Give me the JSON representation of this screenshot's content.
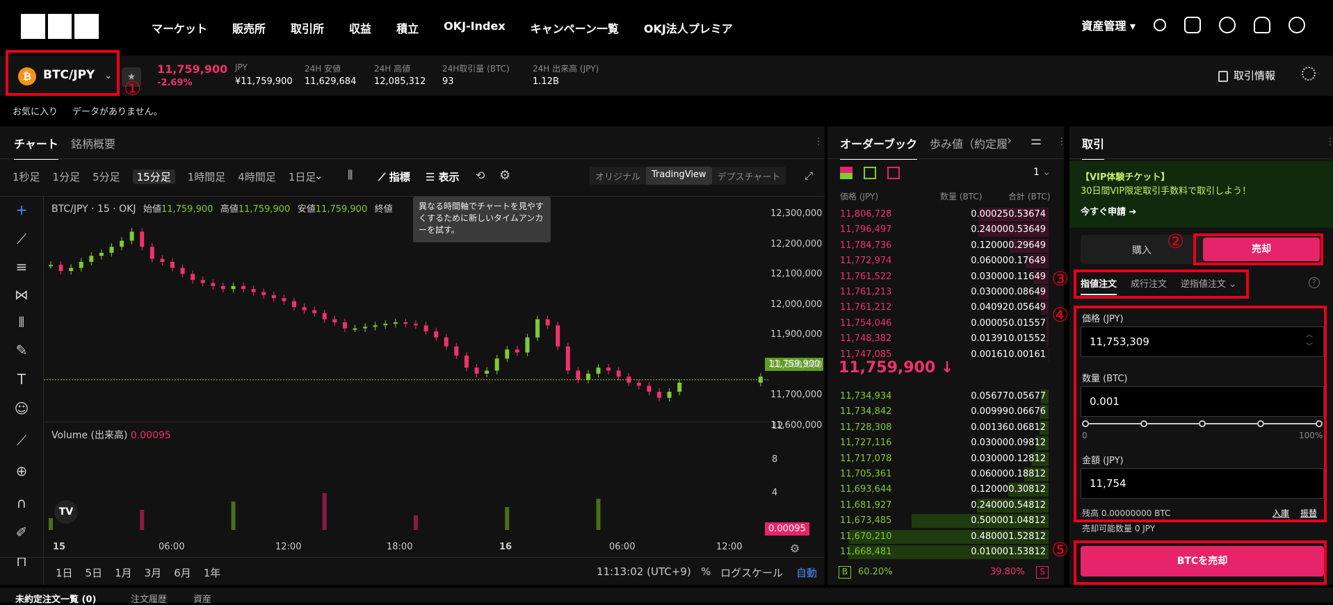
{
  "nav": {
    "links": [
      "マーケット",
      "販売所",
      "取引所",
      "収益",
      "積立",
      "OKJ-Index",
      "キャンペーン一覧",
      "OKJ法人プレミア"
    ],
    "asset_menu": "資産管理"
  },
  "ticker": {
    "pair": "BTC/JPY",
    "price": "11,759,900",
    "change": "-2.69%",
    "stats": [
      {
        "label": "JPY",
        "value": "¥11,759,900"
      },
      {
        "label": "24H 安値",
        "value": "11,629,684"
      },
      {
        "label": "24H 高値",
        "value": "12,085,312"
      },
      {
        "label": "24H取引量 (BTC)",
        "value": "93"
      },
      {
        "label": "24H 出来高 (JPY)",
        "value": "1.12B"
      }
    ],
    "trade_info": "取引情報"
  },
  "favorites": {
    "label": "お気に入り",
    "empty": "データがありません。"
  },
  "chart": {
    "tabs": [
      "チャート",
      "銘柄概要"
    ],
    "timeframes": [
      "1秒足",
      "1分足",
      "5分足",
      "15分足",
      "1時間足",
      "4時間足",
      "1日足"
    ],
    "active_tf": "15分足",
    "indicator": "指標",
    "display": "表示",
    "views": [
      "オリジナル",
      "TradingView",
      "デプスチャート"
    ],
    "active_view": "TradingView",
    "legend": {
      "symbol": "BTC/JPY · 15 · OKJ",
      "open_l": "始値",
      "open": "11,759,900",
      "high_l": "高値",
      "high": "11,759,900",
      "low_l": "安値",
      "low": "11,759,900",
      "close_l": "終値"
    },
    "tooltip": "異なる時間軸でチャートを見やすくするために新しいタイムアンカーを試す。",
    "price_ticks": [
      "12,300,000",
      "12,200,000",
      "12,100,000",
      "12,000,000",
      "11,900,000",
      "11,800,000",
      "11,700,000",
      "11,600,000"
    ],
    "current_price": "11,759,900",
    "volume_label": "Volume (出来高)",
    "volume_value": "0.00095",
    "volume_ticks": [
      "12",
      "8",
      "4"
    ],
    "volume_current": "0.00095",
    "time_ticks": [
      "15",
      "06:00",
      "12:00",
      "18:00",
      "16",
      "06:00",
      "12:00"
    ],
    "ranges": [
      "1日",
      "5日",
      "1月",
      "3月",
      "6月",
      "1年"
    ],
    "clock": "11:13:02 (UTC+9)",
    "pct": "%",
    "log": "ログスケール",
    "auto": "自動"
  },
  "chart_data": {
    "type": "candlestick",
    "title": "BTC/JPY · 15 · OKJ",
    "ylim": [
      11550000,
      12350000
    ],
    "close_series": [
      12140000,
      12120000,
      12130000,
      12150000,
      12170000,
      12180000,
      12200000,
      12220000,
      12250000,
      12200000,
      12160000,
      12150000,
      12130000,
      12110000,
      12090000,
      12080000,
      12070000,
      12060000,
      12070000,
      12060000,
      12050000,
      12040000,
      12030000,
      12020000,
      12000000,
      11990000,
      11980000,
      11960000,
      11950000,
      11930000,
      11930000,
      11935000,
      11940000,
      11945000,
      11950000,
      11945000,
      11940000,
      11920000,
      11900000,
      11870000,
      11840000,
      11800000,
      11780000,
      11790000,
      11830000,
      11860000,
      11850000,
      11900000,
      11960000,
      11940000,
      11870000,
      11790000,
      11760000,
      11780000,
      11800000,
      11790000,
      11770000,
      11750000,
      11740000,
      11720000,
      11700000,
      11720000,
      11750000,
      null,
      null,
      null,
      null,
      null,
      null,
      null,
      11770000,
      11760000
    ]
  },
  "orderbook": {
    "tabs": [
      "オーダーブック",
      "歩み値（約定履"
    ],
    "depth": "1",
    "headers": [
      "価格 (JPY)",
      "数量 (BTC)",
      "合計 (BTC)"
    ],
    "asks": [
      [
        "11,806,728",
        "0.00025",
        "0.53674"
      ],
      [
        "11,796,497",
        "0.24000",
        "0.53649"
      ],
      [
        "11,784,736",
        "0.12000",
        "0.29649"
      ],
      [
        "11,772,974",
        "0.06000",
        "0.17649"
      ],
      [
        "11,761,522",
        "0.03000",
        "0.11649"
      ],
      [
        "11,761,213",
        "0.03000",
        "0.08649"
      ],
      [
        "11,761,212",
        "0.04092",
        "0.05649"
      ],
      [
        "11,754,046",
        "0.00005",
        "0.01557"
      ],
      [
        "11,748,382",
        "0.01391",
        "0.01552"
      ],
      [
        "11,747,085",
        "0.00161",
        "0.00161"
      ]
    ],
    "mid": "11,759,900 ↓",
    "bids": [
      [
        "11,734,934",
        "0.05677",
        "0.05677"
      ],
      [
        "11,734,842",
        "0.00999",
        "0.06676"
      ],
      [
        "11,728,308",
        "0.00136",
        "0.06812"
      ],
      [
        "11,727,116",
        "0.03000",
        "0.09812"
      ],
      [
        "11,717,078",
        "0.03000",
        "0.12812"
      ],
      [
        "11,705,361",
        "0.06000",
        "0.18812"
      ],
      [
        "11,693,644",
        "0.12000",
        "0.30812"
      ],
      [
        "11,681,927",
        "0.24000",
        "0.54812"
      ],
      [
        "11,673,485",
        "0.50000",
        "1.04812"
      ],
      [
        "11,670,210",
        "0.48000",
        "1.52812"
      ],
      [
        "11,668,481",
        "0.01000",
        "1.53812"
      ]
    ],
    "buy_pct": "60.20%",
    "sell_pct": "39.80%",
    "b": "B",
    "s": "S"
  },
  "trade": {
    "title": "取引",
    "promo_title": "【VIP体験チケット】",
    "promo_text": "30日間VIP限定取引手数料で取引しよう！",
    "promo_link": "今すぐ申請 ➔",
    "buy": "購入",
    "sell": "売却",
    "order_types": [
      "指値注文",
      "成行注文",
      "逆指値注文"
    ],
    "price_label": "価格 (JPY)",
    "price": "11,753,309",
    "qty_label": "数量 (BTC)",
    "qty": "0.001",
    "slider_min": "0",
    "slider_max": "100%",
    "amount_label": "金額 (JPY)",
    "amount": "11,754",
    "balance": "残高 0.00000000 BTC",
    "deposit": "入庫",
    "transfer": "振替",
    "available": "売却可能数量 0 JPY",
    "submit": "BTCを売却"
  },
  "annotations": [
    "①",
    "②",
    "③",
    "④",
    "⑤"
  ],
  "bottom": {
    "tabs": [
      "未約定注文一覧 (0)",
      "注文履歴",
      "資産"
    ]
  },
  "colors": {
    "up": "#7fcb33",
    "down": "#f0316a",
    "accent": "#e6246a",
    "highlight": "#e8001c"
  }
}
